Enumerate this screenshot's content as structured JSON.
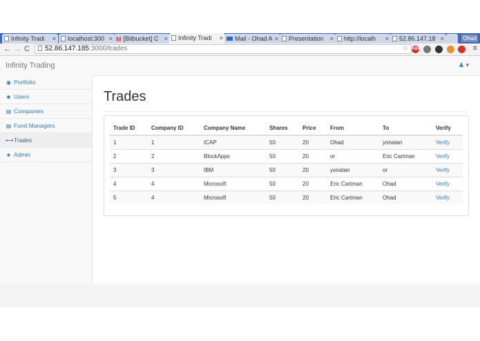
{
  "browser": {
    "tabs": [
      {
        "label": "Infinity Tradi",
        "icon": "page-icon",
        "active": false
      },
      {
        "label": "localhost:300",
        "icon": "page-icon",
        "active": false
      },
      {
        "label": "[Bitbucket] C",
        "icon": "gmail-icon",
        "active": false
      },
      {
        "label": "Infinity Tradi",
        "icon": "page-icon",
        "active": true
      },
      {
        "label": "Mail - Ohad A",
        "icon": "mail-icon",
        "active": false
      },
      {
        "label": "Presentation",
        "icon": "page-icon",
        "active": false
      },
      {
        "label": "http://localh",
        "icon": "page-icon",
        "active": false
      },
      {
        "label": "52.86.147.18",
        "icon": "page-icon",
        "active": false
      }
    ],
    "profile_name": "Ohad",
    "url_host": "52.86.147.185",
    "url_path": ":3000/trades",
    "extensions": [
      {
        "name": "adblock-icon",
        "label": "ABP",
        "color": "#d9302c"
      },
      {
        "name": "extension-gray-icon",
        "label": "",
        "color": "#777777"
      },
      {
        "name": "extension-dark-icon",
        "label": "",
        "color": "#333333"
      },
      {
        "name": "extension-orange-icon",
        "label": "",
        "color": "#e8912d"
      },
      {
        "name": "extension-red-icon",
        "label": "",
        "color": "#d9302c"
      }
    ]
  },
  "app": {
    "brand": "Infinity Trading",
    "user_caret": "▾"
  },
  "sidebar": {
    "items": [
      {
        "label": "Portfolio",
        "icon": "dashboard-icon",
        "glyph": "◉",
        "active": false
      },
      {
        "label": "Users",
        "icon": "users-icon",
        "glyph": "☻",
        "active": false
      },
      {
        "label": "Companies",
        "icon": "table-icon",
        "glyph": "▤",
        "active": false
      },
      {
        "label": "Fund Managers",
        "icon": "table-icon",
        "glyph": "▤",
        "active": false
      },
      {
        "label": "Trades",
        "icon": "exchange-icon",
        "glyph": "⟷",
        "active": true
      },
      {
        "label": "Admin",
        "icon": "sitemap-icon",
        "glyph": "♣",
        "active": false
      }
    ]
  },
  "main": {
    "title": "Trades",
    "table": {
      "headers": [
        "Trade ID",
        "Company ID",
        "Company Name",
        "Shares",
        "Price",
        "From",
        "To",
        "Verify"
      ],
      "rows": [
        {
          "trade_id": "1",
          "company_id": "1",
          "company_name": "ICAP",
          "shares": "50",
          "price": "20",
          "from": "Ohad",
          "to": "yonatan",
          "verify": "Verify"
        },
        {
          "trade_id": "2",
          "company_id": "2",
          "company_name": "BlockApps",
          "shares": "50",
          "price": "20",
          "from": "or",
          "to": "Eric Cartman",
          "verify": "Verify"
        },
        {
          "trade_id": "3",
          "company_id": "3",
          "company_name": "IBM",
          "shares": "50",
          "price": "20",
          "from": "yonatan",
          "to": "or",
          "verify": "Verify"
        },
        {
          "trade_id": "4",
          "company_id": "4",
          "company_name": "Microsoft",
          "shares": "50",
          "price": "20",
          "from": "Eric Cartman",
          "to": "Ohad",
          "verify": "Verify"
        },
        {
          "trade_id": "5",
          "company_id": "4",
          "company_name": "Microsoft",
          "shares": "50",
          "price": "20",
          "from": "Eric Cartman",
          "to": "Ohad",
          "verify": "Verify"
        }
      ]
    }
  },
  "colors": {
    "tabstrip": "#3f68b3",
    "link": "#337ab7"
  }
}
